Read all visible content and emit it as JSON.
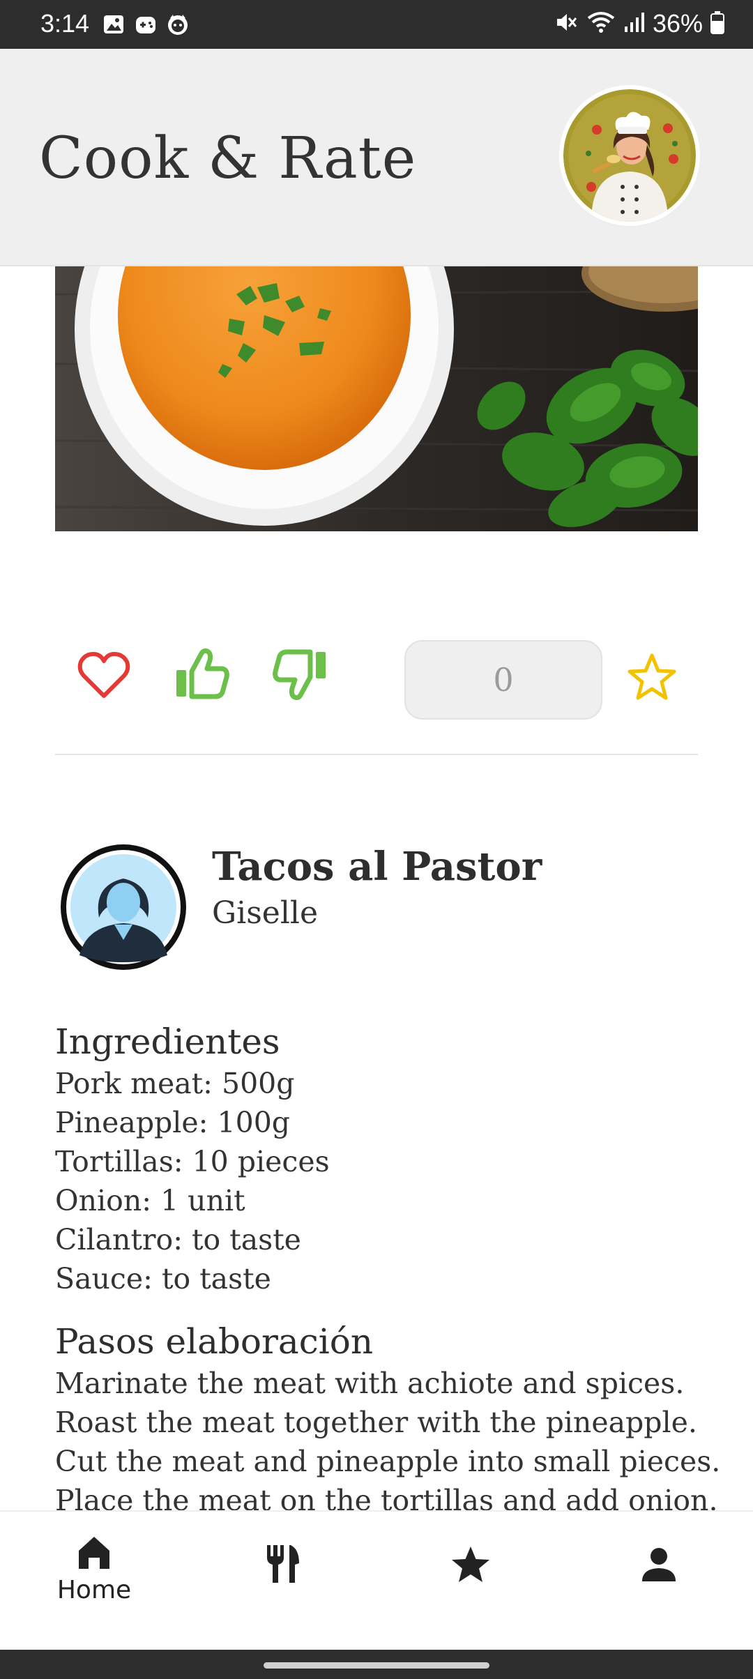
{
  "status_bar": {
    "time": "3:14",
    "battery": "36%"
  },
  "app": {
    "title": "Cook & Rate"
  },
  "actions": {
    "rating_value": "0",
    "accent_like": "#6cc04a",
    "accent_heart": "#e53935",
    "accent_star": "#f2c200"
  },
  "recipe": {
    "title": "Tacos al Pastor",
    "author": "Giselle",
    "ingredients_title": "Ingredientes",
    "ingredients": [
      "Pork meat: 500g",
      "Pineapple: 100g",
      "Tortillas: 10 pieces",
      "Onion: 1 unit",
      "Cilantro: to taste",
      "Sauce: to taste"
    ],
    "steps_title": "Pasos elaboración",
    "steps": [
      "Marinate the meat with achiote and spices.",
      "Roast the meat together with the pineapple.",
      "Cut the meat and pineapple into small pieces.",
      "Place the meat on the tortillas and add onion."
    ]
  },
  "bottom_nav": {
    "items": [
      {
        "label": "Home",
        "icon": "home-icon"
      },
      {
        "label": "",
        "icon": "cutlery-icon"
      },
      {
        "label": "",
        "icon": "star-icon"
      },
      {
        "label": "",
        "icon": "person-icon"
      }
    ]
  }
}
